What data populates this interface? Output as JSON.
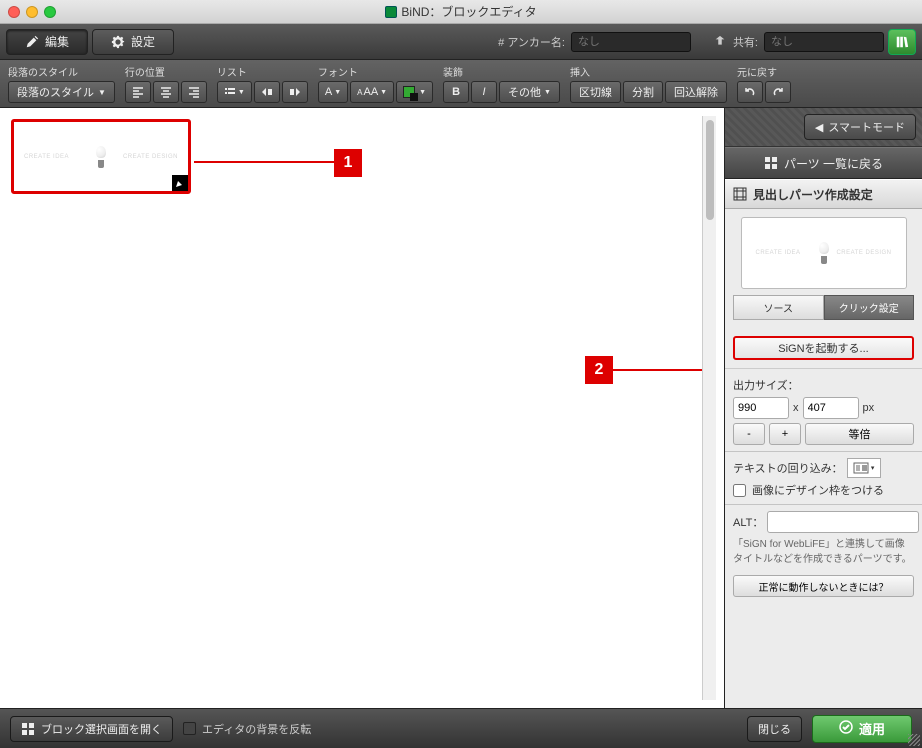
{
  "window": {
    "title": "BiND：ブロックエディタ"
  },
  "tabs": {
    "edit": "編集",
    "settings": "設定"
  },
  "anchor": {
    "label": "# アンカー名:",
    "placeholder": "なし"
  },
  "share": {
    "label": "共有:",
    "placeholder": "なし"
  },
  "toolbar": {
    "paragraph_style_label": "段落のスタイル",
    "paragraph_style_btn": "段落のスタイル",
    "line_pos_label": "行の位置",
    "list_label": "リスト",
    "font_label": "フォント",
    "font_a": "A",
    "font_aa": "AA",
    "decoration_label": "装飾",
    "bold": "B",
    "italic": "I",
    "other": "その他",
    "insert_label": "挿入",
    "insert_line": "区切線",
    "insert_split": "分割",
    "insert_unwrap": "回込解除",
    "undo_label": "元に戻す"
  },
  "callouts": {
    "one": "1",
    "two": "2"
  },
  "preview_text": {
    "left": "CREATE IDEA",
    "right": "CREATE DESIGN"
  },
  "side": {
    "smart": "スマートモード",
    "parts_back": "パーツ 一覧に戻る",
    "section_title": "見出しパーツ作成設定",
    "tab_source": "ソース",
    "tab_click": "クリック設定",
    "sign_btn": "SiGNを起動する...",
    "output_size_label": "出力サイズ：",
    "width": "990",
    "sep": "x",
    "height": "407",
    "unit": "px",
    "minus": "-",
    "plus": "+",
    "same": "等倍",
    "textwrap_label": "テキストの回り込み：",
    "frame_checkbox": "画像にデザイン枠をつける",
    "alt_label": "ALT：",
    "alt_value": "",
    "help": "「SiGN for WebLiFE」と連携して画像タイトルなどを作成できるパーツです。",
    "help_btn": "正常に動作しないときには？"
  },
  "footer": {
    "block_select": "ブロック選択画面を開く",
    "invert_bg": "エディタの背景を反転",
    "close": "閉じる",
    "apply": "適用"
  }
}
